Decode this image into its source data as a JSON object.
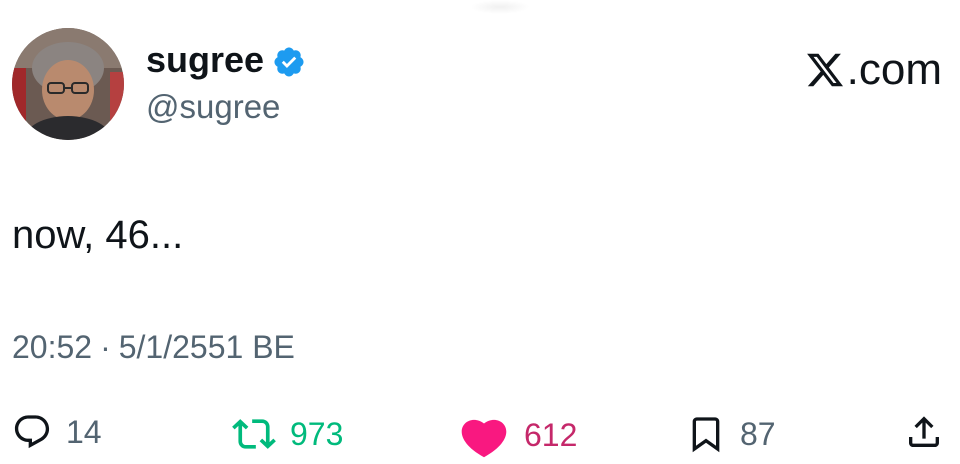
{
  "author": {
    "display_name": "sugree",
    "handle": "@sugree",
    "verified": true,
    "verified_color": "#1d9bf0",
    "avatar_icon": "user-avatar-photo"
  },
  "brand": {
    "icon": "x-logo-icon",
    "suffix": ".com"
  },
  "tweet": {
    "text": "now, 46..."
  },
  "meta": {
    "time": "20:52",
    "separator": "·",
    "date": "5/1/2551 BE"
  },
  "actions": {
    "replies": {
      "icon": "reply-icon",
      "count": "14"
    },
    "retweets": {
      "icon": "retweet-icon",
      "count": "973",
      "color": "#00ba7c"
    },
    "likes": {
      "icon": "heart-icon",
      "count": "612",
      "color": "#f91880"
    },
    "bookmarks": {
      "icon": "bookmark-icon",
      "count": "87"
    },
    "share": {
      "icon": "share-icon"
    }
  }
}
